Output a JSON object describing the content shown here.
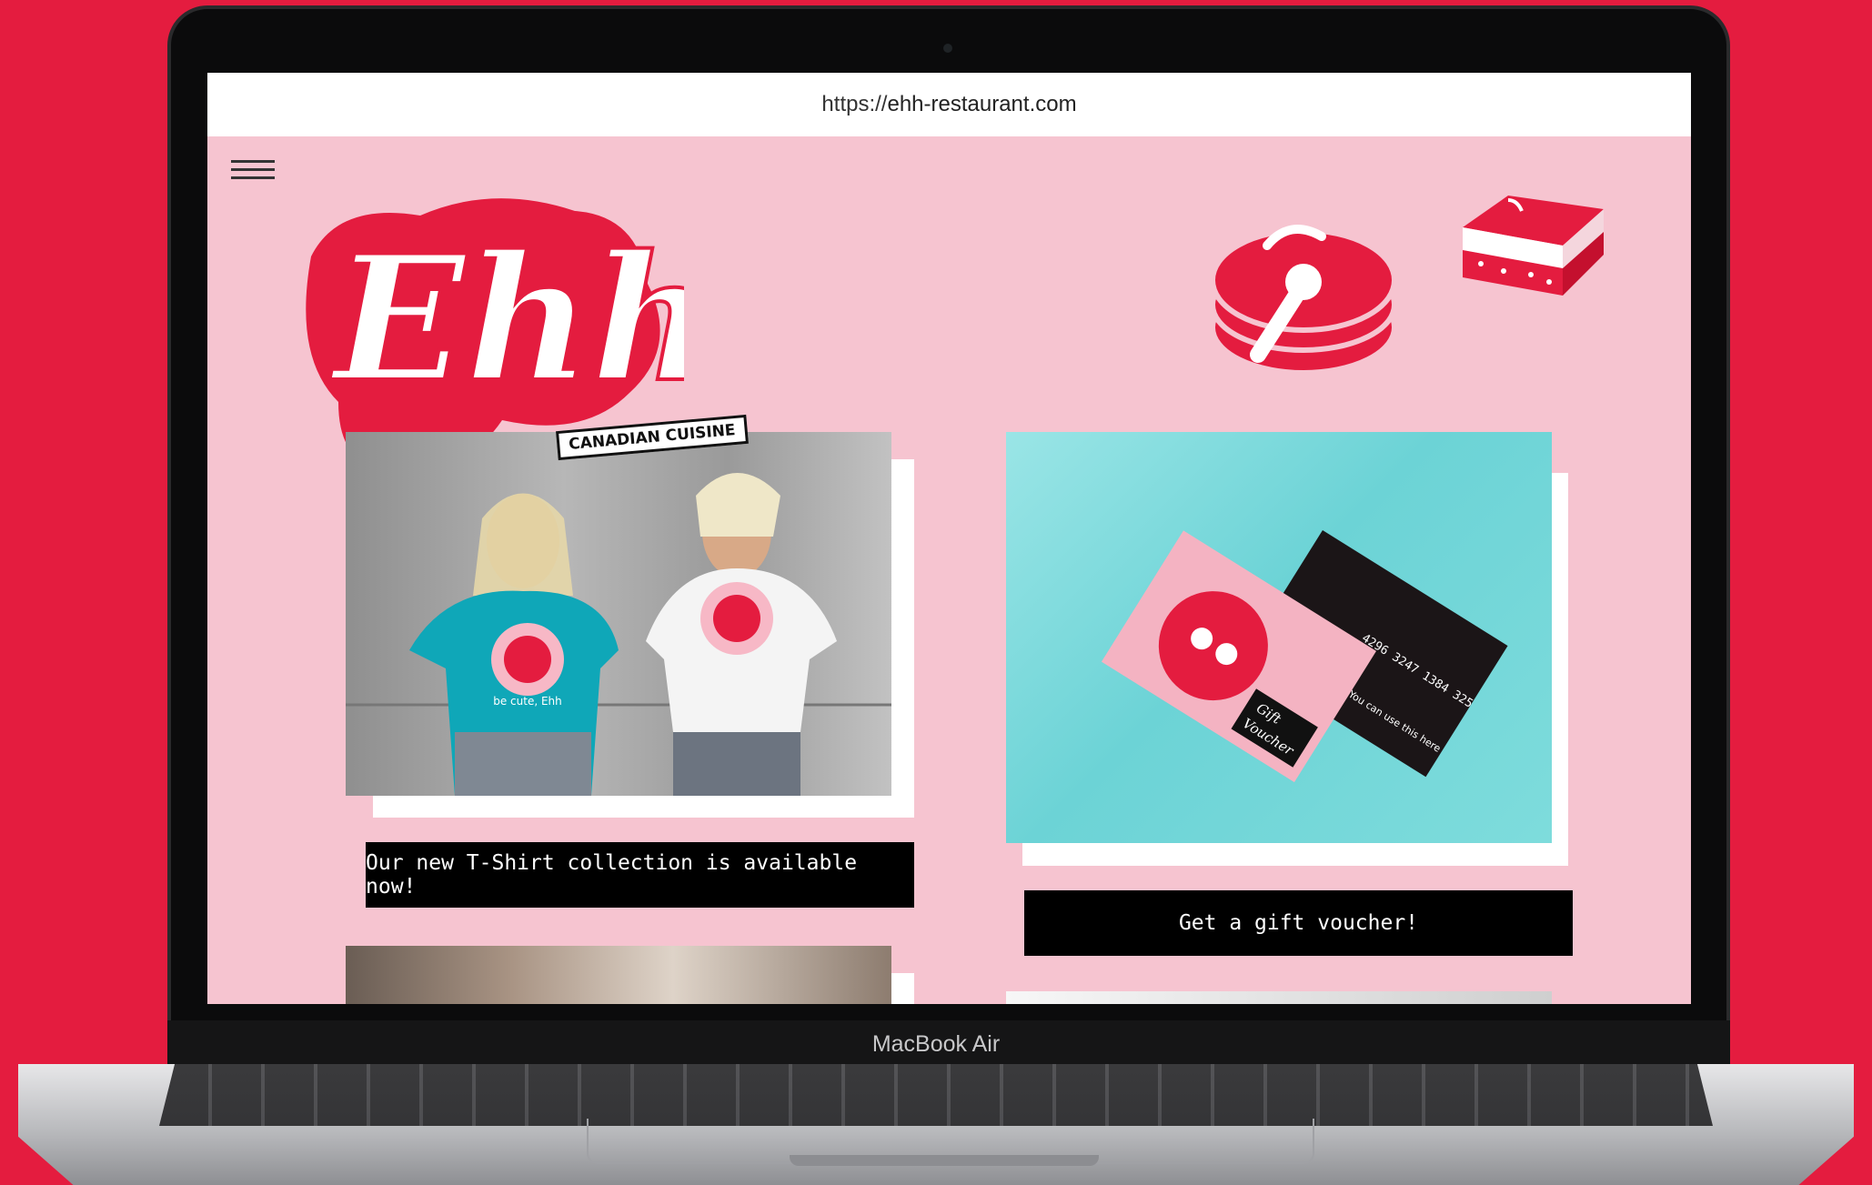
{
  "device": {
    "label": "MacBook Air"
  },
  "browser": {
    "url_scheme": "https://",
    "url_host": "ehh-restaurant.com"
  },
  "site": {
    "logo_text": "Ehh",
    "tagline": "CANADIAN CUISINE",
    "cards": [
      {
        "button_label": "Our new T-Shirt collection is available now!"
      },
      {
        "button_label": "Get a gift voucher!"
      }
    ],
    "tshirt_print": "be cute, Ehh",
    "voucher": {
      "number": "4296 3247 1384 325",
      "title_line1": "Gift",
      "title_line2": "Voucher",
      "side_text": "You can use this here"
    }
  },
  "colors": {
    "brand_red": "#e41c3f",
    "site_pink": "#f6c4d0",
    "teal": "#7fdcdc",
    "black": "#000000"
  }
}
